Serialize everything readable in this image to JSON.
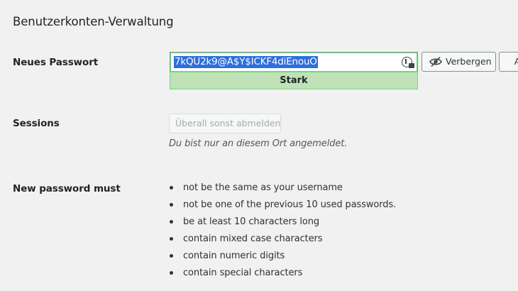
{
  "section": {
    "title": "Benutzerkonten-Verwaltung"
  },
  "password": {
    "label": "Neues Passwort",
    "value": "7kQU2k9@A$Y$ICKF4diEnouO",
    "strength": "Stark",
    "hide_label": "Verbergen",
    "cancel_label": "Ab"
  },
  "sessions": {
    "label": "Sessions",
    "logout_label": "Überall sonst abmelden",
    "note": "Du bist nur an diesem Ort angemeldet."
  },
  "requirements": {
    "label": "New password must",
    "items": [
      "not be the same as your username",
      "not be one of the previous 10 used passwords.",
      "be at least 10 characters long",
      "contain mixed case characters",
      "contain numeric digits",
      "contain special characters"
    ]
  }
}
